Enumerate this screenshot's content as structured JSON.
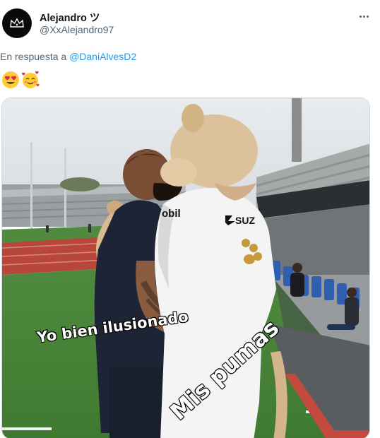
{
  "user": {
    "display_name": "Alejandro ツ",
    "handle": "@XxAlejandro97"
  },
  "reply": {
    "prefix": "En respuesta a",
    "mention": "@DaniAlvesD2"
  },
  "emojis": [
    "smiling-face-with-heart-eyes",
    "smiling-face-with-hearts"
  ],
  "media": {
    "caption_left": "Yo bien ilusionado",
    "caption_right": "Mis pumas",
    "shirt_sponsor_left": "obil",
    "shirt_sponsor_right": "SUZ"
  },
  "colors": {
    "link": "#1d9bf0",
    "secondary_text": "#536471",
    "border": "#cfd9de"
  }
}
